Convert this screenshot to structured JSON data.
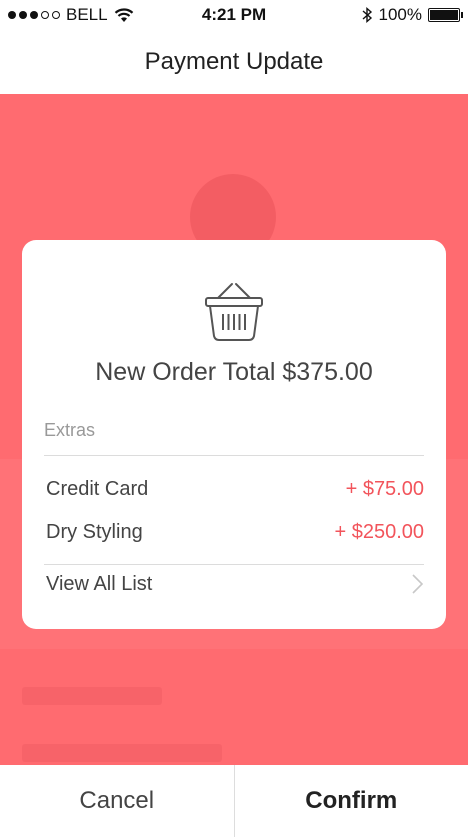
{
  "status_bar": {
    "carrier": "BELL",
    "time": "4:21 PM",
    "battery": "100%"
  },
  "nav": {
    "title": "Payment Update"
  },
  "card": {
    "order_total": "New Order Total $375.00",
    "extras_label": "Extras",
    "items": [
      {
        "label": "Credit Card",
        "price": "+ $75.00"
      },
      {
        "label": "Dry Styling",
        "price": "+ $250.00"
      }
    ],
    "view_all": "View All List",
    "icon": "shopping-basket-icon"
  },
  "bottom_bar": {
    "cancel": "Cancel",
    "confirm": "Confirm"
  },
  "colors": {
    "accent": "#ff6b70",
    "price": "#f2545b"
  }
}
